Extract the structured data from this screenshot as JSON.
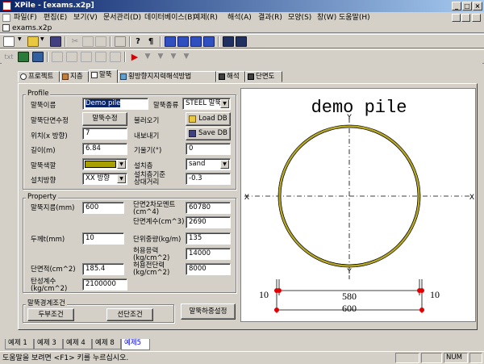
{
  "window": {
    "title": "XPile - [exams.x2p]",
    "minimize": "_",
    "maximize": "□",
    "close": "×"
  },
  "menu": [
    "파일(F)",
    "편집(E)",
    "보기(V)",
    "문서관리(D)",
    "데이터베이스(B)",
    "예제(R)",
    "해석(A)",
    "결과(R)",
    "모양(S)",
    "창(W)",
    "도움말(H)"
  ],
  "mdi": {
    "doc_title": "exams.x2p"
  },
  "tabs": [
    "프로젝트",
    "지층",
    "말뚝",
    "횡방향지지력해석방법",
    "해석",
    "단면도"
  ],
  "profile": {
    "legend": "Profile",
    "pile_name_label": "말뚝이름",
    "pile_name_value": "Demo pile",
    "pile_type_label": "말뚝종류",
    "pile_type_value": "STEEL 말뚝",
    "section_edit_label": "말뚝단면수정",
    "section_edit_button": "말뚝수정",
    "load_label": "불러오기",
    "load_button": "Load DB",
    "position_label": "위치(x 방향)",
    "position_value": "7",
    "export_label": "내보내기",
    "save_button": "Save DB",
    "length_label": "길이(m)",
    "length_value": "6.84",
    "batter_label": "기울기(°)",
    "batter_value": "0",
    "color_label": "말뚝색깔",
    "layer_label": "설치층",
    "layer_value": "sand",
    "direction_label": "설치방향",
    "direction_value": "XX 방향",
    "depth_label_1": "설치층기준",
    "depth_label_2": "상대거리",
    "depth_value": "-0.3"
  },
  "property": {
    "legend": "Property",
    "diameter_label": "말뚝지름(mm)",
    "diameter_value": "600",
    "moment_label_1": "단면2차모멘트",
    "moment_label_2": "(cm^4)",
    "moment_value": "60780",
    "modulus_label": "단면계수(cm^3)",
    "modulus_value": "2690",
    "thickness_label": "두께t(mm)",
    "thickness_value": "10",
    "unit_weight_label": "단위중량(kg/m)",
    "unit_weight_value": "135",
    "allow_stress_label_1": "허용응력",
    "allow_stress_label_2": "(kg/cm^2)",
    "allow_stress_value": "14000",
    "area_label": "단면적(cm^2)",
    "area_value": "185.4",
    "allow_shear_label_1": "허용전단력",
    "allow_shear_label_2": "(kg/cm^2)",
    "allow_shear_value": "8000",
    "elastic_label_1": "탄성계수",
    "elastic_label_2": "(kg/cm^2)",
    "elastic_value": "2100000"
  },
  "boundary": {
    "legend": "말뚝경계조건",
    "head_button": "두부조건",
    "tip_button": "선단조건",
    "load_button": "말뚝하중설정"
  },
  "drawing": {
    "title": "demo pile",
    "axis_label_top": "Y",
    "axis_label_bottom": "Y",
    "axis_label_left": "X",
    "axis_label_right": "X",
    "dim_left": "10",
    "dim_right": "10",
    "dim_inner": "580",
    "dim_outer": "600"
  },
  "bottom_tabs": [
    "예제 1",
    "예제 3",
    "예제 4",
    "예제 8",
    "예제5"
  ],
  "status": {
    "text": "도움말을 보려면 <F1> 키를 누르십시오.",
    "num": "NUM"
  },
  "colors": {
    "pile_color": "#a8a000",
    "pile_ring": "#b8a818",
    "active_tab_text": "#0000ff"
  }
}
